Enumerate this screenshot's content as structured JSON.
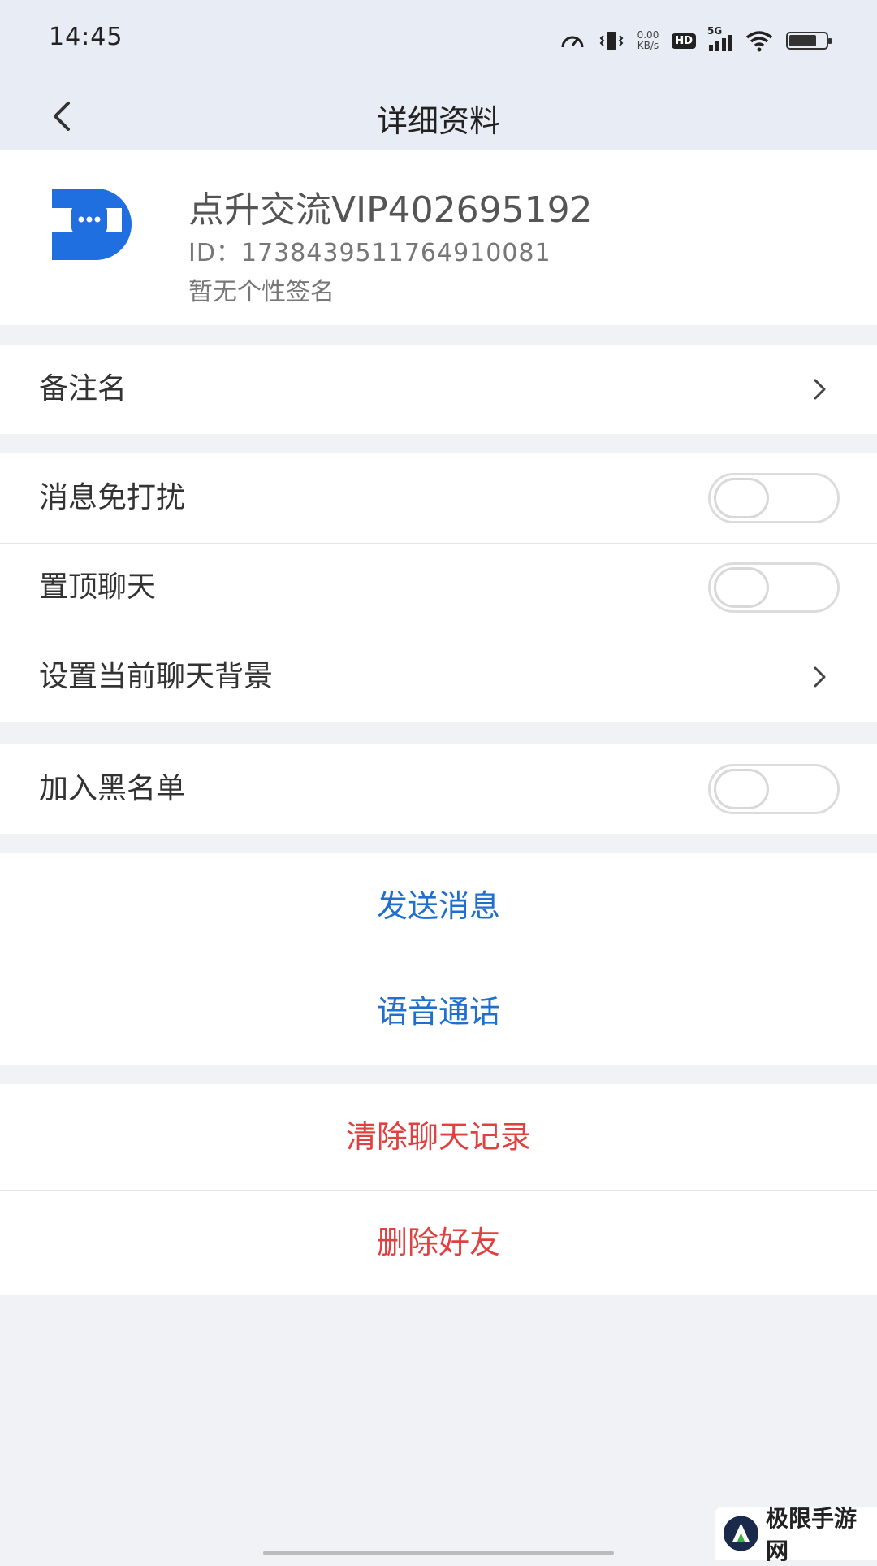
{
  "status_bar": {
    "time": "14:45",
    "net_speed_value": "0.00",
    "net_speed_unit": "KB/s",
    "hd_label": "HD",
    "signal_label": "5G",
    "battery_level": 0.75,
    "icons": [
      "speedometer-icon",
      "vibrate-icon",
      "wifi-icon",
      "battery-icon"
    ]
  },
  "nav": {
    "title": "详细资料"
  },
  "profile": {
    "name": "点升交流VIP402695192",
    "id_text": "ID：1738439511764910081",
    "signature": "暂无个性签名",
    "avatar_color": "#1f6fe0"
  },
  "settings": {
    "remark_label": "备注名",
    "mute_label": "消息免打扰",
    "mute_on": false,
    "pin_label": "置顶聊天",
    "pin_on": false,
    "background_label": "设置当前聊天背景",
    "blacklist_label": "加入黑名单",
    "blacklist_on": false
  },
  "actions": {
    "send_message": "发送消息",
    "voice_call": "语音通话",
    "clear_history": "清除聊天记录",
    "delete_friend": "删除好友"
  },
  "colors": {
    "action_blue": "#1f6fcf",
    "action_red": "#e04040",
    "header_bg": "#e8edf5"
  },
  "watermark": {
    "text": "极限手游网"
  }
}
